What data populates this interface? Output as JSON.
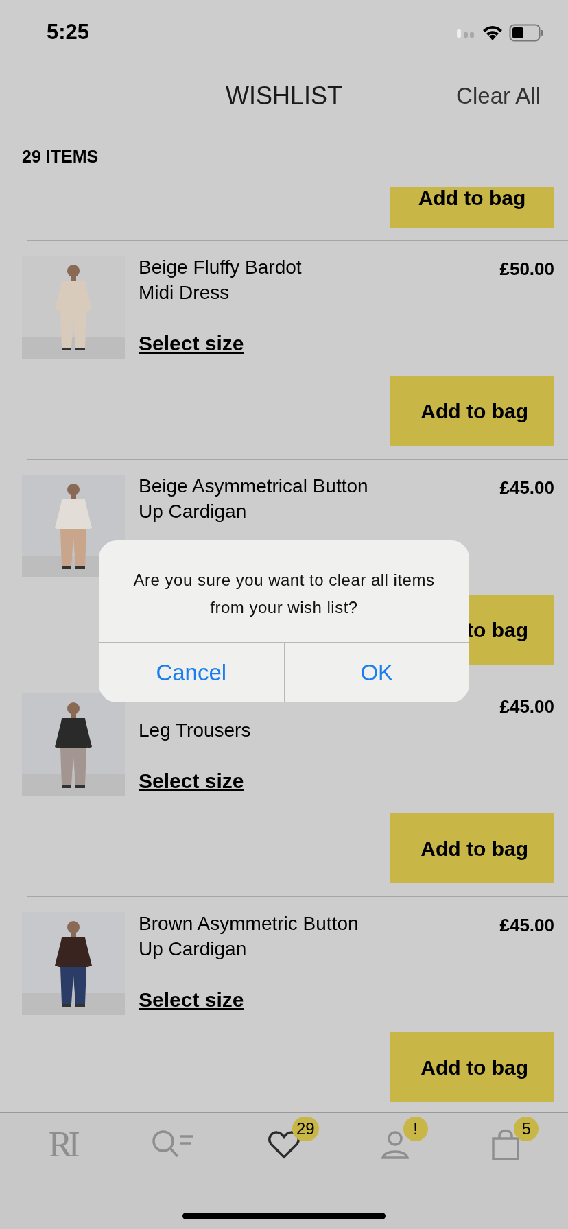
{
  "status_bar": {
    "time": "5:25"
  },
  "header": {
    "title": "WISHLIST",
    "action": "Clear All"
  },
  "count": "29 ITEMS",
  "partial_item": {
    "button": "Add to bag"
  },
  "items": [
    {
      "title": "Beige Fluffy Bardot\nMidi  Dress",
      "price": "£50.00",
      "size_link": "Select size",
      "button": "Add to bag"
    },
    {
      "title": "Beige Asymmetrical Button\nUp Cardigan",
      "price": "£45.00",
      "button": "to bag"
    },
    {
      "title": "Leg Trousers",
      "price": "£45.00",
      "size_link": "Select size",
      "button": "Add to bag"
    },
    {
      "title": "Brown Asymmetric Button\nUp Cardigan",
      "price": "£45.00",
      "size_link": "Select size",
      "button": "Add to bag"
    }
  ],
  "dialog": {
    "message": "Are you sure you want to clear all items from your wish list?",
    "buttons": [
      "Cancel",
      "OK"
    ]
  },
  "tab_bar": [
    {
      "kind": "logo",
      "label": "RI",
      "selected": false
    },
    {
      "kind": "search",
      "selected": false
    },
    {
      "kind": "wishlist",
      "badge": "29",
      "selected": true
    },
    {
      "kind": "account",
      "badge": "!",
      "selected": false
    },
    {
      "kind": "bag",
      "badge": "5",
      "selected": false
    }
  ]
}
